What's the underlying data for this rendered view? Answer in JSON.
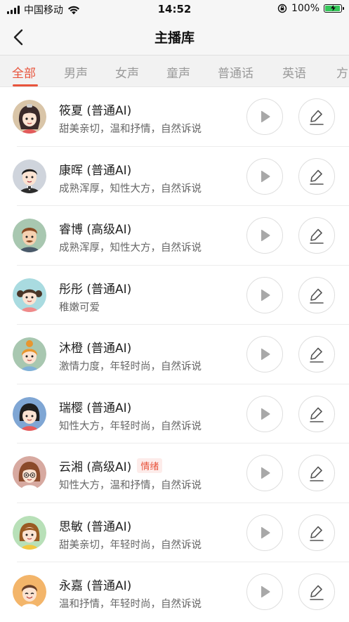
{
  "status_bar": {
    "carrier": "中国移动",
    "time": "14:52",
    "battery": "100%",
    "battery_level": 1.0
  },
  "nav": {
    "title": "主播库",
    "back_icon": "chevron-left-icon"
  },
  "tabs": [
    {
      "label": "全部",
      "active": true
    },
    {
      "label": "男声",
      "active": false
    },
    {
      "label": "女声",
      "active": false
    },
    {
      "label": "童声",
      "active": false
    },
    {
      "label": "普通话",
      "active": false
    },
    {
      "label": "英语",
      "active": false
    },
    {
      "label": "方",
      "active": false
    }
  ],
  "colors": {
    "accent": "#e8543c",
    "tag_bg": "#fdecea",
    "text_primary": "#222222",
    "text_secondary": "#666666"
  },
  "voices": [
    {
      "name": "筱夏 (普通AI)",
      "desc": "甜美亲切，温和抒情，自然诉说",
      "tag": "",
      "avatar": "girl-dark-hair-icon"
    },
    {
      "name": "康晖 (普通AI)",
      "desc": "成熟浑厚，知性大方，自然诉说",
      "tag": "",
      "avatar": "man-suit-icon"
    },
    {
      "name": "睿博 (高级AI)",
      "desc": "成熟浑厚，知性大方，自然诉说",
      "tag": "",
      "avatar": "man-brown-hair-icon"
    },
    {
      "name": "彤彤 (普通AI)",
      "desc": "稚嫩可爱",
      "tag": "",
      "avatar": "child-girl-icon"
    },
    {
      "name": "沐橙 (普通AI)",
      "desc": "激情力度，年轻时尚，自然诉说",
      "tag": "",
      "avatar": "girl-orange-hair-icon"
    },
    {
      "name": "瑞樱 (普通AI)",
      "desc": "知性大方，年轻时尚，自然诉说",
      "tag": "",
      "avatar": "girl-black-hair-icon"
    },
    {
      "name": "云湘 (高级AI)",
      "desc": "知性大方，温和抒情，自然诉说",
      "tag": "情绪",
      "avatar": "woman-glasses-icon"
    },
    {
      "name": "思敏 (普通AI)",
      "desc": "甜美亲切，年轻时尚，自然诉说",
      "tag": "",
      "avatar": "girl-brown-hair-icon"
    },
    {
      "name": "永嘉 (普通AI)",
      "desc": "温和抒情，年轻时尚，自然诉说",
      "tag": "",
      "avatar": "boy-smiling-icon"
    }
  ]
}
